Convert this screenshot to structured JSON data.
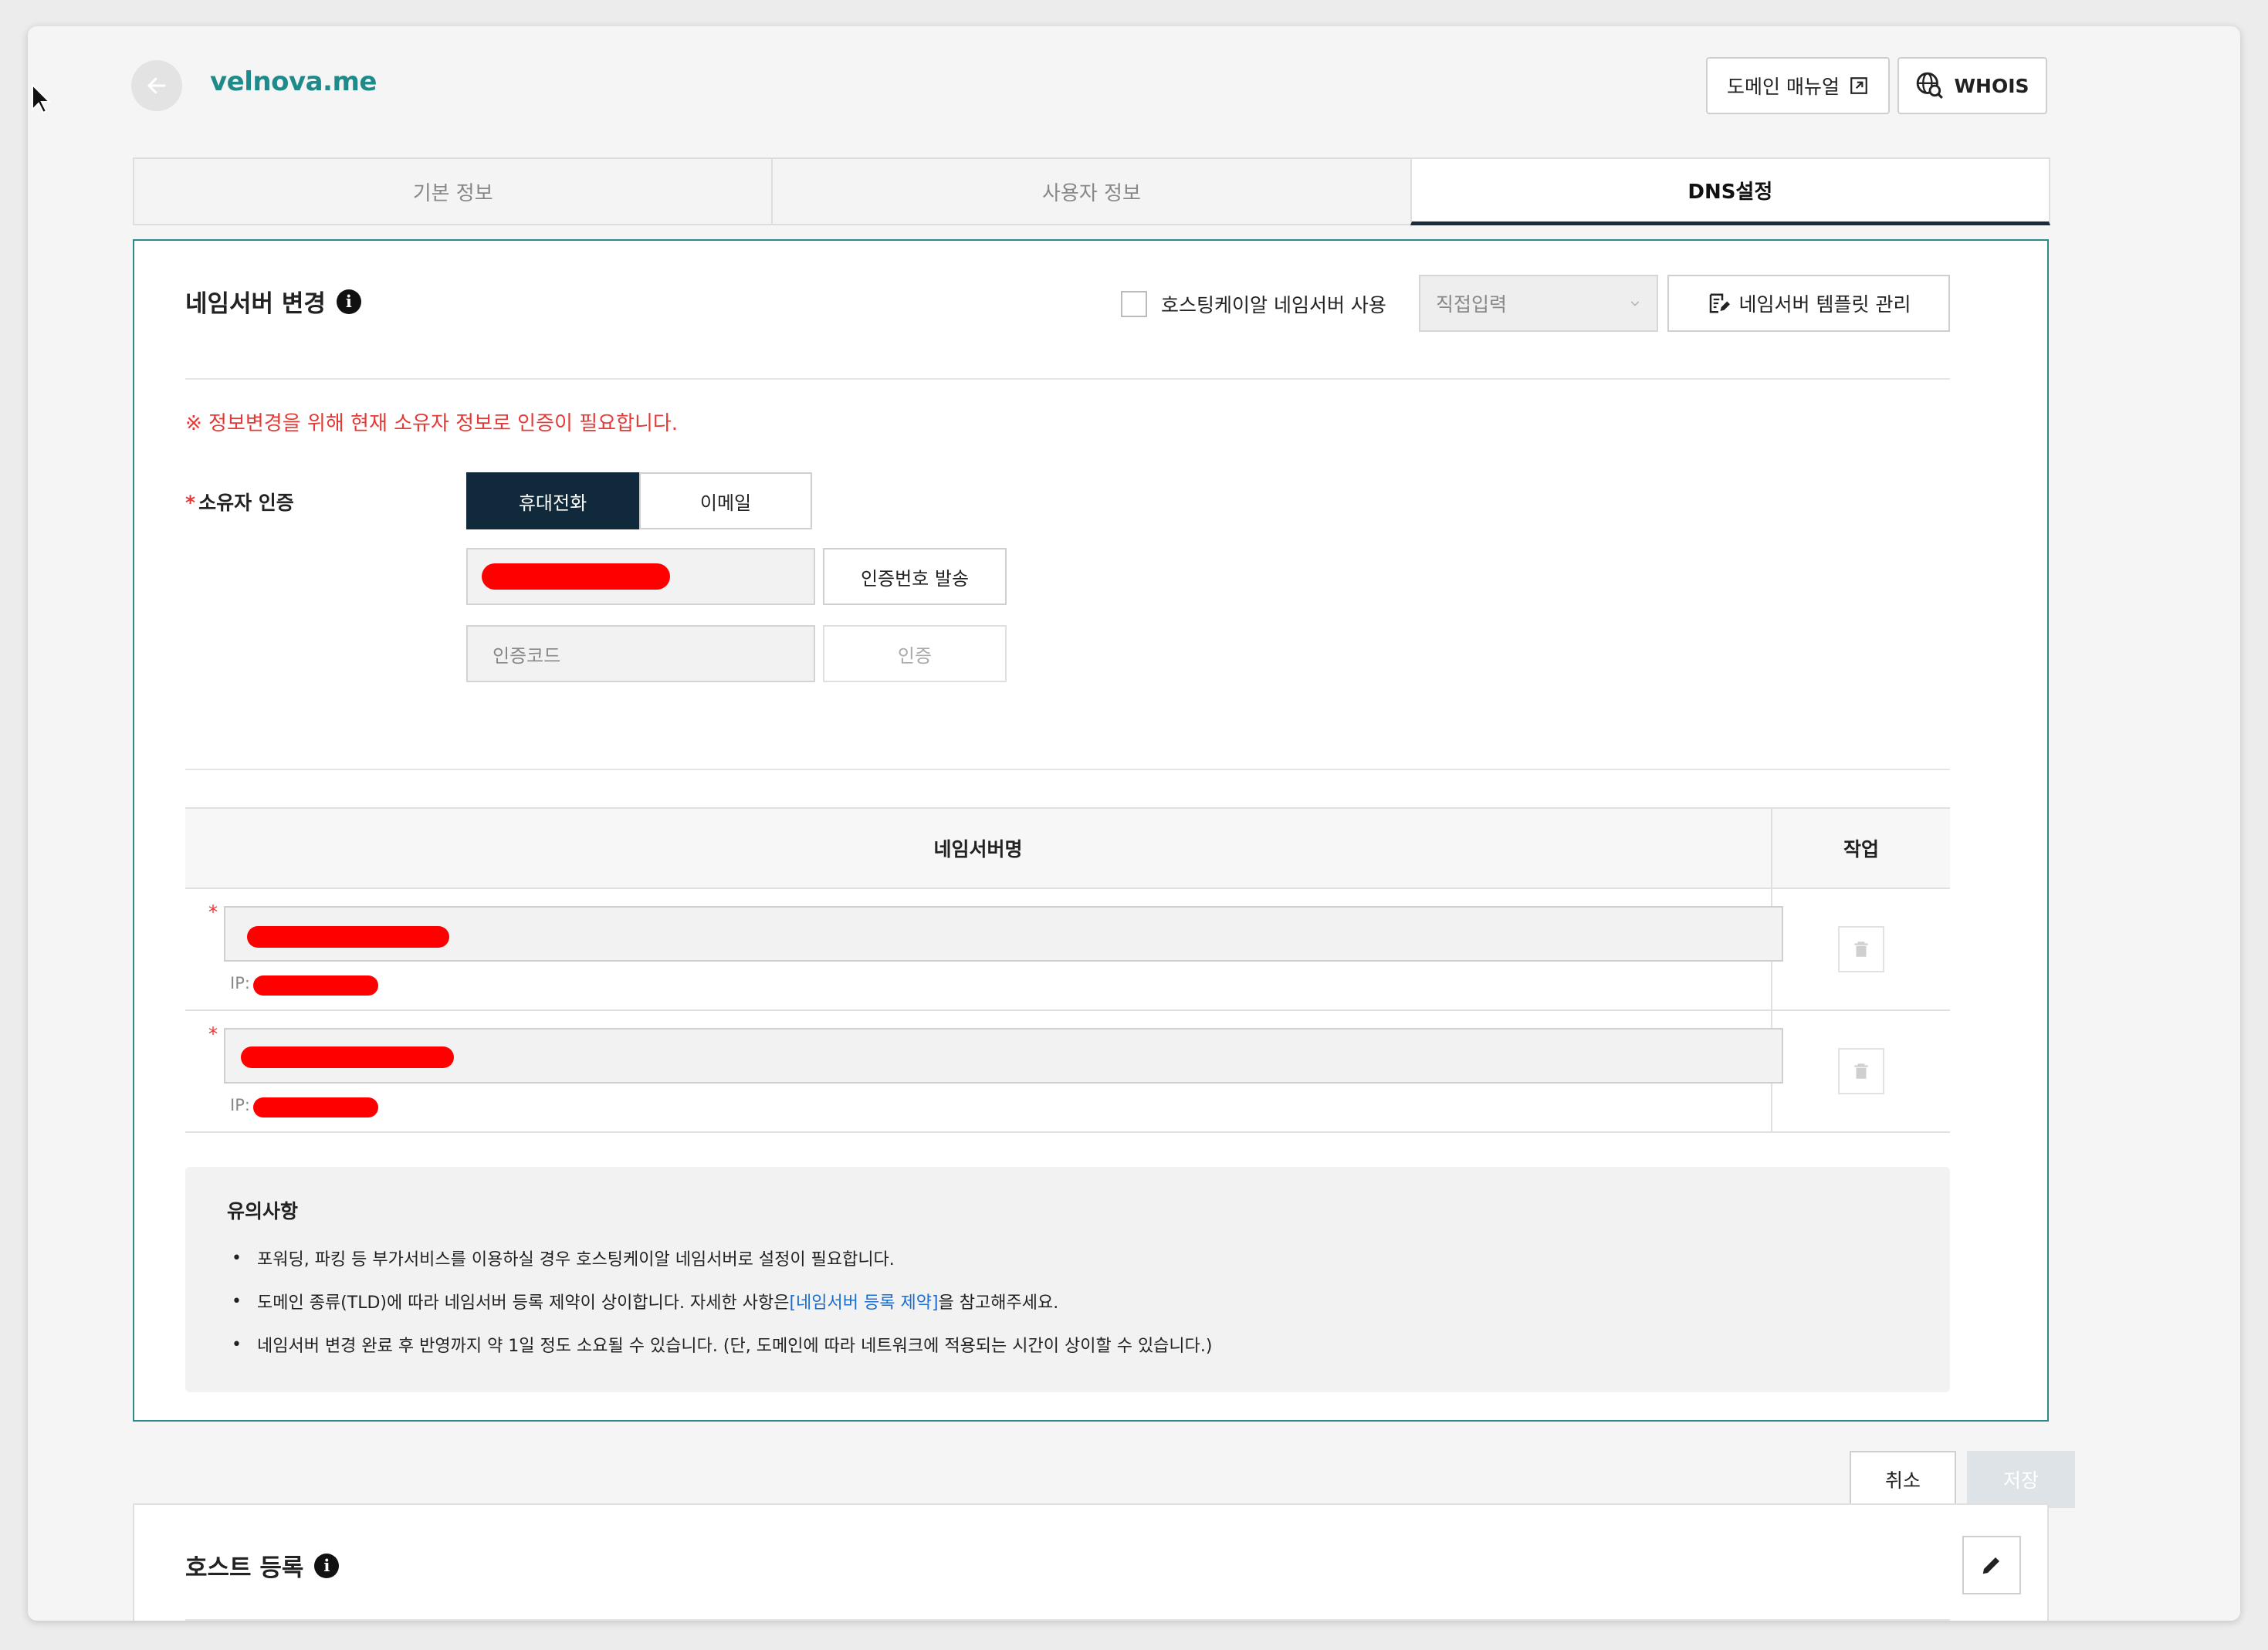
{
  "header": {
    "domain": "velnova.me",
    "manual_label": "도메인 매뉴얼",
    "whois_label": "WHOIS"
  },
  "tabs": [
    {
      "label": "기본 정보",
      "active": false
    },
    {
      "label": "사용자 정보",
      "active": false
    },
    {
      "label": "DNS설정",
      "active": true
    }
  ],
  "nameserver": {
    "title": "네임서버 변경",
    "hosting_checkbox_label": "호스팅케이알 네임서버 사용",
    "hosting_checked": false,
    "select_value": "직접입력",
    "template_button": "네임서버 템플릿 관리",
    "warning": "※ 정보변경을 위해 현재 소유자 정보로 인증이 필요합니다.",
    "owner_auth_label": "소유자 인증",
    "auth_options": [
      "휴대전화",
      "이메일"
    ],
    "selected_auth": "휴대전화",
    "send_code_button": "인증번호 발송",
    "code_placeholder": "인증코드",
    "verify_button": "인증",
    "table": {
      "col_name": "네임서버명",
      "col_action": "작업",
      "rows": [
        {
          "ip_label": "IP:"
        },
        {
          "ip_label": "IP:"
        }
      ]
    }
  },
  "notes": {
    "title": "유의사항",
    "items": [
      "포워딩, 파킹 등 부가서비스를 이용하실 경우 호스팅케이알 네임서버로 설정이 필요합니다.",
      "도메인 종류(TLD)에 따라 네임서버 등록 제약이 상이합니다. 자세한 사항은 ",
      "네임서버 변경 완료 후 반영까지 약 1일 정도 소요될 수 있습니다. (단, 도메인에 따라 네트워크에 적용되는 시간이 상이할 수 있습니다.)"
    ],
    "link_text": "[네임서버 등록 제약]",
    "link_suffix": "을 참고해주세요."
  },
  "actions": {
    "cancel": "취소",
    "save": "저장"
  },
  "host": {
    "title": "호스트 등록"
  },
  "colors": {
    "accent_teal": "#1f8a8a",
    "dark_navy": "#10293b",
    "warning_red": "#e53935",
    "link_blue": "#1a6dd1"
  }
}
